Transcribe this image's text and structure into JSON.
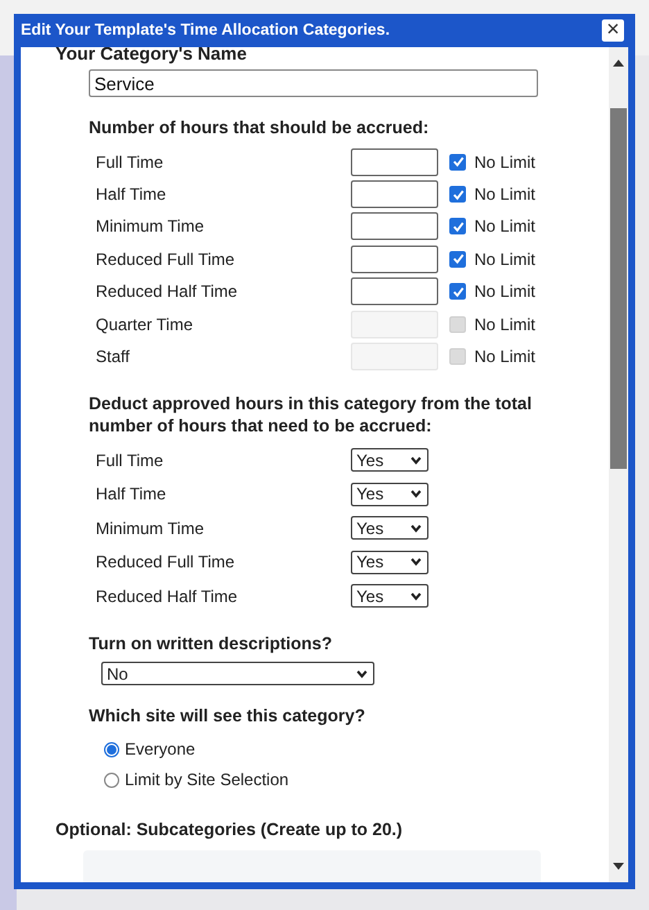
{
  "dialog": {
    "title": "Edit Your Template's Time Allocation Categories.",
    "close": "×",
    "name_label": "Your Category's Name",
    "name_value": "Service",
    "accrued": {
      "heading": "Number of hours that should be accrued:",
      "rows": [
        {
          "label": "Full Time",
          "limit_label": "No Limit",
          "no_limit": true,
          "disabled": false
        },
        {
          "label": "Half Time",
          "limit_label": "No Limit",
          "no_limit": true,
          "disabled": false
        },
        {
          "label": "Minimum Time",
          "limit_label": "No Limit",
          "no_limit": true,
          "disabled": false
        },
        {
          "label": "Reduced Full Time",
          "limit_label": "No Limit",
          "no_limit": true,
          "disabled": false
        },
        {
          "label": "Reduced Half Time",
          "limit_label": "No Limit",
          "no_limit": true,
          "disabled": false
        },
        {
          "label": "Quarter Time",
          "limit_label": "No Limit",
          "no_limit": false,
          "disabled": true
        },
        {
          "label": "Staff",
          "limit_label": "No Limit",
          "no_limit": false,
          "disabled": true
        }
      ]
    },
    "deduct": {
      "heading": "Deduct approved hours in this category from the total number of hours that need to be accrued:",
      "rows": [
        {
          "label": "Full Time",
          "value": "Yes"
        },
        {
          "label": "Half Time",
          "value": "Yes"
        },
        {
          "label": "Minimum Time",
          "value": "Yes"
        },
        {
          "label": "Reduced Full Time",
          "value": "Yes"
        },
        {
          "label": "Reduced Half Time",
          "value": "Yes"
        }
      ]
    },
    "descriptions": {
      "heading": "Turn on written descriptions?",
      "value": "No"
    },
    "visibility": {
      "heading": "Which site will see this category?",
      "options": [
        {
          "label": "Everyone",
          "selected": true
        },
        {
          "label": "Limit by Site Selection",
          "selected": false
        }
      ]
    },
    "subcategories": {
      "heading": "Optional: Subcategories (Create up to 20.)"
    }
  }
}
